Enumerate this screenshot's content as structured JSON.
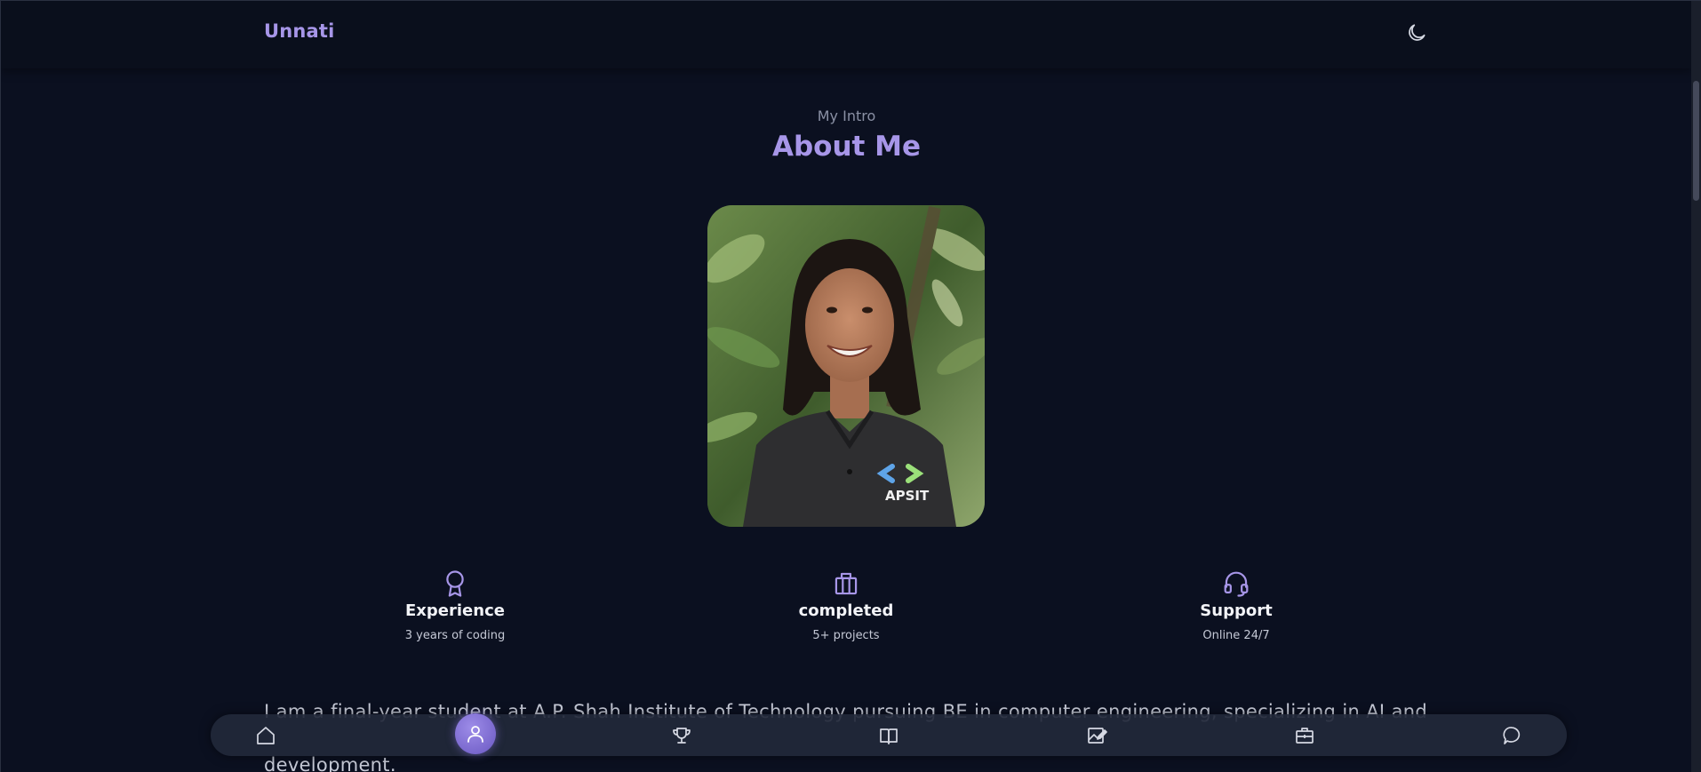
{
  "header": {
    "brand": "Unnati",
    "theme_toggle_icon": "moon-icon"
  },
  "about": {
    "subtitle": "My Intro",
    "title": "About Me",
    "photo_alt": "Portrait photo",
    "photo_shirt_text": "APSIT"
  },
  "stats": [
    {
      "icon": "award-icon",
      "title": "Experience",
      "subtitle": "3 years of coding"
    },
    {
      "icon": "briefcase-icon",
      "title": "completed",
      "subtitle": "5+ projects"
    },
    {
      "icon": "headset-icon",
      "title": "Support",
      "subtitle": "Online 24/7"
    }
  ],
  "description": "I am a final-year student at A.P. Shah Institute of Technology pursuing BE in computer engineering, specializing in AI and development.",
  "bottom_nav": {
    "items": [
      {
        "icon": "home-icon",
        "active": false
      },
      {
        "icon": "user-icon",
        "active": true
      },
      {
        "icon": "trophy-icon",
        "active": false
      },
      {
        "icon": "book-icon",
        "active": false
      },
      {
        "icon": "image-edit-icon",
        "active": false
      },
      {
        "icon": "briefcase-icon",
        "active": false
      },
      {
        "icon": "message-icon",
        "active": false
      }
    ]
  },
  "colors": {
    "background": "#0b1020",
    "accent": "#a796e8",
    "nav_bg": "#22283a"
  }
}
